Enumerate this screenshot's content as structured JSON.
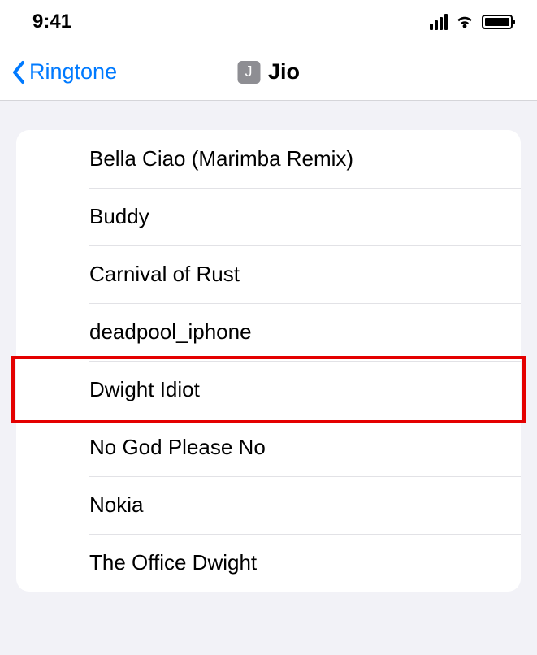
{
  "status": {
    "time": "9:41"
  },
  "nav": {
    "back_label": "Ringtone",
    "title_badge": "J",
    "title": "Jio"
  },
  "ringtones": [
    {
      "label": "Bella Ciao (Marimba Remix)"
    },
    {
      "label": "Buddy"
    },
    {
      "label": "Carnival of Rust"
    },
    {
      "label": "deadpool_iphone"
    },
    {
      "label": "Dwight Idiot",
      "highlighted": true
    },
    {
      "label": "No God Please No"
    },
    {
      "label": "Nokia"
    },
    {
      "label": "The Office Dwight"
    }
  ],
  "highlight": {
    "color": "#e40000"
  }
}
